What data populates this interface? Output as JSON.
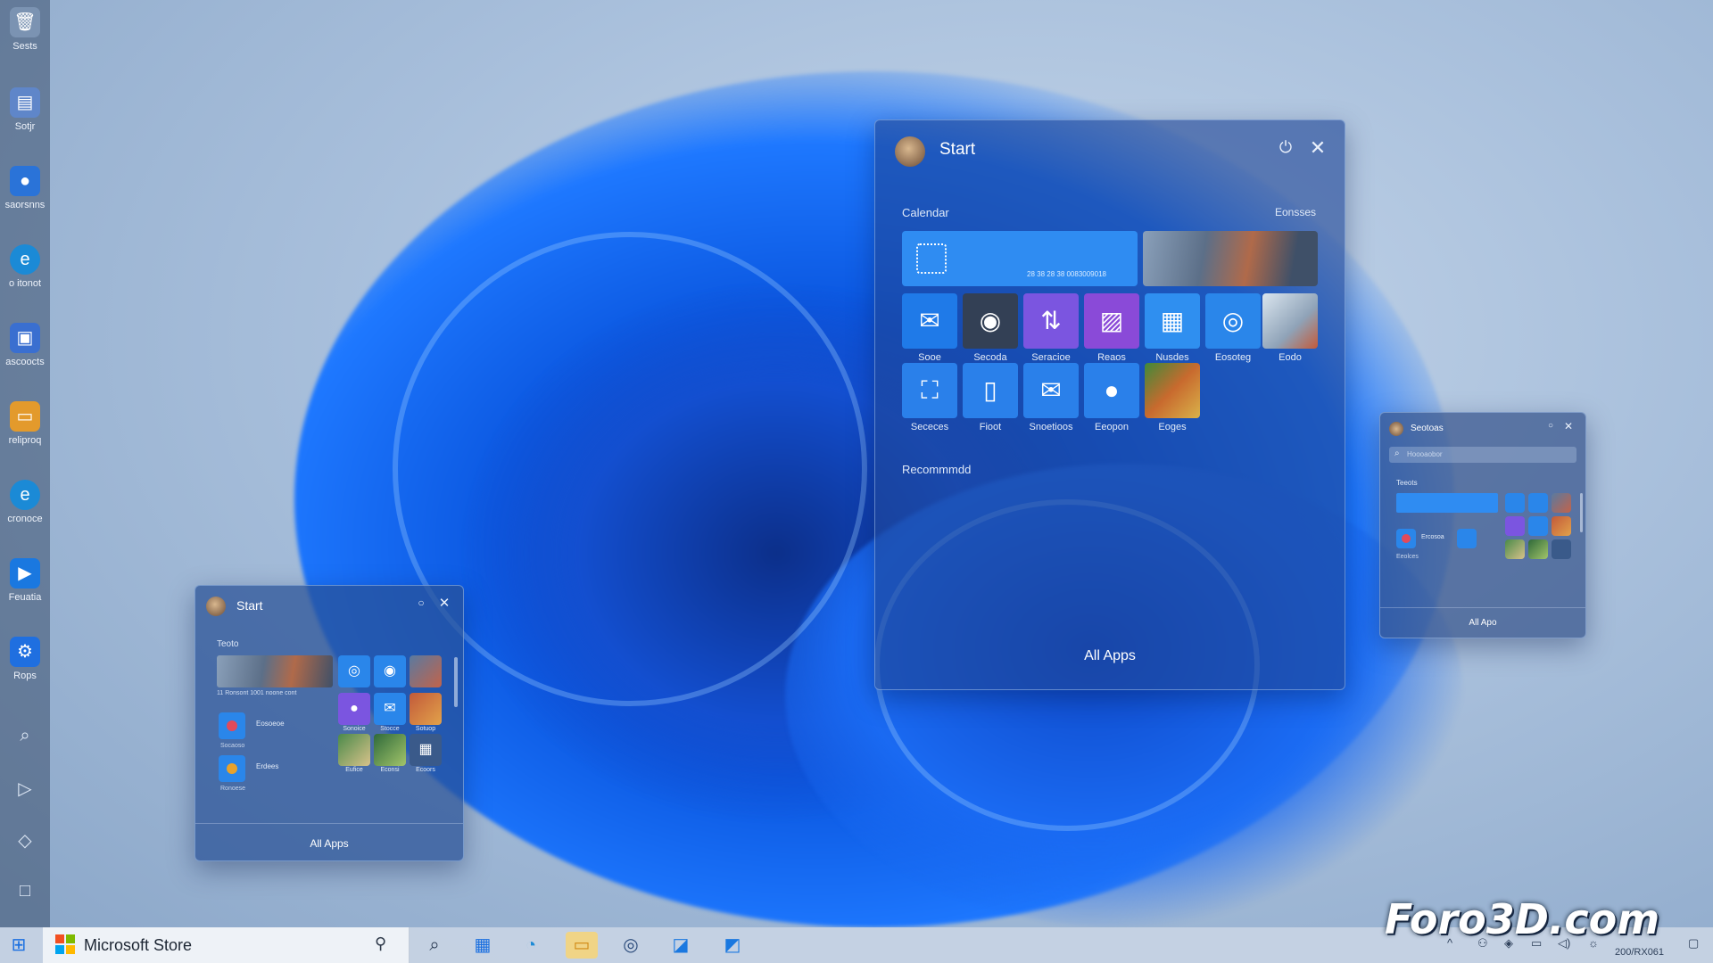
{
  "desktop": {
    "icons": [
      {
        "label": "Sests",
        "icon": "recycle-bin-icon",
        "color": "#7b93b2"
      },
      {
        "label": "Sotjr",
        "icon": "document-icon",
        "color": "#5f86c9"
      },
      {
        "label": "saorsnns",
        "icon": "chat-icon",
        "color": "#2a73d8"
      },
      {
        "label": "o itonot",
        "icon": "edge-icon",
        "color": "#1b8ad6"
      },
      {
        "label": "ascoocts",
        "icon": "app-icon",
        "color": "#3a6fd0"
      },
      {
        "label": "reliproq",
        "icon": "folder-icon",
        "color": "#e39a2c"
      },
      {
        "label": "cronoce",
        "icon": "edge-icon",
        "color": "#1b8ad6"
      },
      {
        "label": "Feuatia",
        "icon": "media-icon",
        "color": "#1a78e0"
      },
      {
        "label": "Rops",
        "icon": "settings-icon",
        "color": "#1f6fe0"
      }
    ],
    "tools": [
      "search-icon",
      "play-icon",
      "eraser-icon",
      "square-icon"
    ]
  },
  "main_start": {
    "title": "Start",
    "section_left": "Calendar",
    "section_right": "Eonsses",
    "recommended": "Recommmdd",
    "all_apps": "All Apps",
    "tiles_row1": [
      {
        "label": "Sooe",
        "icon": "mail-icon",
        "color": "#1f7ae8"
      },
      {
        "label": "Secoda",
        "icon": "photo-icon",
        "color": "#334055"
      },
      {
        "label": "Seracioe",
        "icon": "share-icon",
        "color": "#7b55e0"
      },
      {
        "label": "Reaos",
        "icon": "gallery-icon",
        "color": "#8a4ad8"
      },
      {
        "label": "Nusdes",
        "icon": "image-icon",
        "color": "#2f8ff0"
      },
      {
        "label": "Eosoteg",
        "icon": "music-icon",
        "color": "#2a86ea"
      },
      {
        "label": "Eodo",
        "icon": "photo-icon",
        "color": "#9fb4c9"
      }
    ],
    "tiles_row2": [
      {
        "label": "Sececes",
        "icon": "map-icon",
        "color": "#2a80ea"
      },
      {
        "label": "Fioot",
        "icon": "document-icon",
        "color": "#2a80ea"
      },
      {
        "label": "Snoetioos",
        "icon": "mail-icon",
        "color": "#2a80ea"
      },
      {
        "label": "Eeopon",
        "icon": "chat-icon",
        "color": "#2a80ea"
      },
      {
        "label": "Eoges",
        "icon": "photo-icon",
        "color": "#c86a2e"
      }
    ],
    "calendar_text": "28 38 28 38 0083009018"
  },
  "small_start_left": {
    "title": "Start",
    "section": "Teoto",
    "row1_caption": "11 Ronsont 1001 noone cont",
    "list": [
      {
        "label": "Eosoeoe",
        "sub": "Socaoso",
        "color": "#e24a5a"
      },
      {
        "label": "Erdees",
        "sub": "Ronoese",
        "color": "#e8a22c"
      }
    ],
    "tile_labels": [
      "Sonoice",
      "Stocce",
      "Sotuop",
      "Eufice",
      "Econsi",
      "Ecoors"
    ],
    "all_apps": "All Apps"
  },
  "small_start_right": {
    "title": "Seotoas",
    "search_placeholder": "Hoooaobor",
    "section": "Teeots",
    "list": [
      "Ercosoa",
      "Eeolces"
    ],
    "all_apps": "All Apo"
  },
  "taskbar": {
    "store_label": "Microsoft Store",
    "apps": [
      "search-icon",
      "widgets-icon",
      "edge-icon",
      "folder-icon",
      "settings-icon",
      "app-icon",
      "app-icon"
    ],
    "clock": "200/RX061"
  },
  "watermark": "Foro3D.com"
}
